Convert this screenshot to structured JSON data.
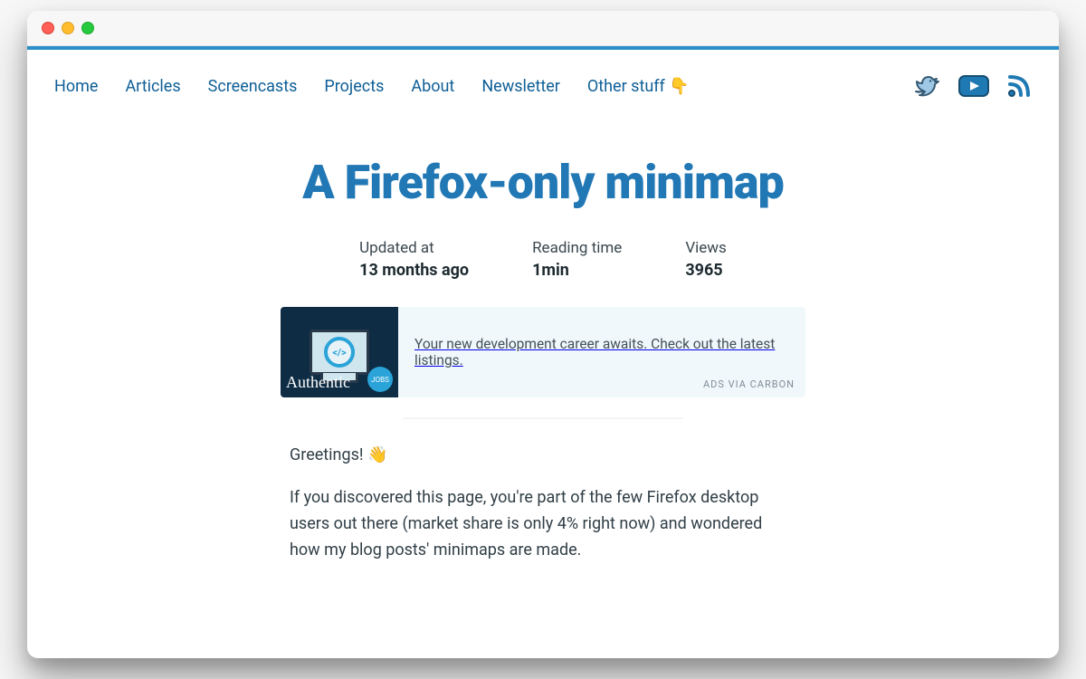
{
  "nav": {
    "items": [
      "Home",
      "Articles",
      "Screencasts",
      "Projects",
      "About",
      "Newsletter",
      "Other stuff 👇"
    ]
  },
  "article": {
    "title": "A Firefox-only minimap",
    "meta": {
      "updated": {
        "label": "Updated at",
        "value": "13 months ago"
      },
      "reading_time": {
        "label": "Reading time",
        "value": "1min"
      },
      "views": {
        "label": "Views",
        "value": "3965"
      }
    },
    "body": [
      "Greetings! 👋",
      "If you discovered this page, you're part of the few Firefox desktop users out there (market share is only 4% right now) and wondered how my blog posts' minimaps are made."
    ]
  },
  "ad": {
    "brand": "Authentic",
    "badge": "JOBS",
    "text": "Your new development career awaits. Check out the latest listings.",
    "via": "ADS VIA CARBON"
  }
}
